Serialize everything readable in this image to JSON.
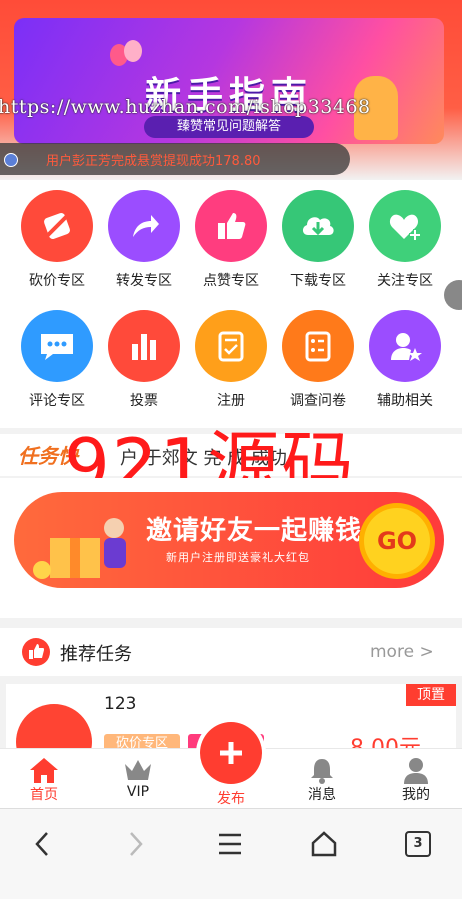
{
  "banner": {
    "title": "新手指南",
    "subtitle": "臻赞常见问题解答"
  },
  "watermark": {
    "url": "https://www.huzhan.com/ishop33468",
    "big": "921源码"
  },
  "ticker": {
    "text": "用户彭正芳完成悬赏提现成功178.80"
  },
  "categories": [
    {
      "label": "砍价专区",
      "icon": "bargain-tag-icon",
      "color": "#ff4a3a"
    },
    {
      "label": "转发专区",
      "icon": "share-arrow-icon",
      "color": "#9b4dff"
    },
    {
      "label": "点赞专区",
      "icon": "thumbs-up-icon",
      "color": "#ff3d7f"
    },
    {
      "label": "下载专区",
      "icon": "cloud-download-icon",
      "color": "#36c777"
    },
    {
      "label": "关注专区",
      "icon": "heart-plus-icon",
      "color": "#3fd07a"
    },
    {
      "label": "评论专区",
      "icon": "chat-bubble-icon",
      "color": "#2f9bff"
    },
    {
      "label": "投票",
      "icon": "bar-chart-icon",
      "color": "#ff4a3a"
    },
    {
      "label": "注册",
      "icon": "form-check-icon",
      "color": "#ff9f1a"
    },
    {
      "label": "调查问卷",
      "icon": "survey-list-icon",
      "color": "#ff7a1a"
    },
    {
      "label": "辅助相关",
      "icon": "user-star-icon",
      "color": "#9b4dff"
    }
  ],
  "task_notice": {
    "title": "任务快",
    "text": "户  于郊文  完    成    成功"
  },
  "invite": {
    "title": "邀请好友一起赚钱",
    "subtitle": "新用户注册即送豪礼大红包",
    "go_label": "GO"
  },
  "recommend": {
    "title": "推荐任务",
    "more": "more >"
  },
  "task_card": {
    "name": "123",
    "badge": "顶置",
    "tag": "砍价专区",
    "price": "8.00元"
  },
  "tabbar": {
    "home": "首页",
    "vip": "VIP",
    "publish": "发布",
    "messages": "消息",
    "mine": "我的"
  },
  "browser": {
    "tab_count": "3"
  },
  "colors": {
    "accent": "#ff3d30",
    "ticker_text": "#ff5a3c"
  }
}
